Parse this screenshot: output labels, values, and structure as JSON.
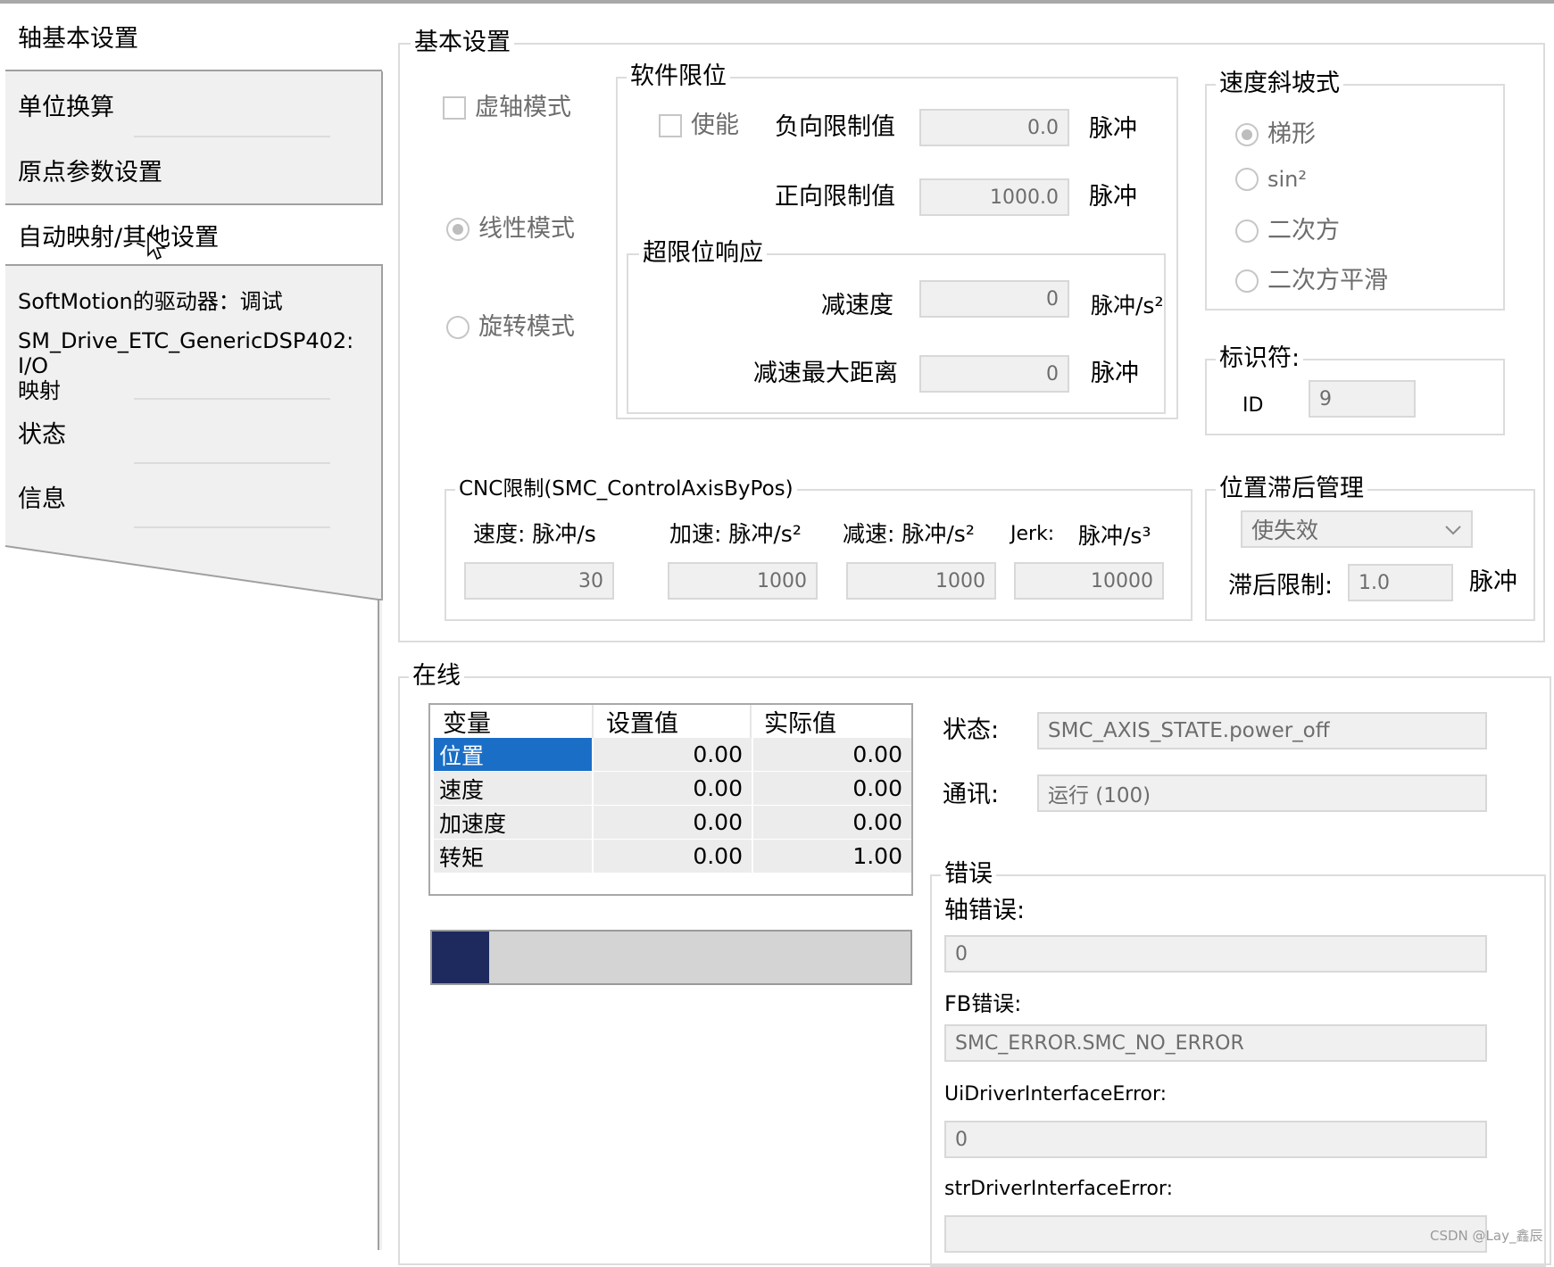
{
  "sidebar": {
    "items": [
      {
        "label": "轴基本设置"
      },
      {
        "label": "单位换算"
      },
      {
        "label": "原点参数设置"
      },
      {
        "label": "自动映射/其他设置"
      },
      {
        "label": "SoftMotion的驱动器：调试"
      },
      {
        "label": "SM_Drive_ETC_GenericDSP402: I/O\n映射"
      },
      {
        "label": "状态"
      },
      {
        "label": "信息"
      }
    ]
  },
  "basic": {
    "title": "基本设置",
    "virtual_mode": "虚轴模式",
    "linear_mode": "线性模式",
    "rotary_mode": "旋转模式",
    "soft_limit": {
      "title": "软件限位",
      "enable": "使能",
      "neg_label": "负向限制值",
      "neg_value": "0.0",
      "pos_label": "正向限制值",
      "pos_value": "1000.0",
      "unit": "脉冲",
      "overlimit_title": "超限位响应",
      "decel_label": "减速度",
      "decel_value": "0",
      "decel_unit": "脉冲/s²",
      "maxdist_label": "减速最大距离",
      "maxdist_value": "0",
      "maxdist_unit": "脉冲"
    },
    "ramp": {
      "title": "速度斜坡式",
      "options": [
        "梯形",
        "sin²",
        "二次方",
        "二次方平滑"
      ],
      "selected": "梯形"
    },
    "identifier": {
      "title": "标识符:",
      "id_label": "ID",
      "id_value": "9"
    },
    "cnc": {
      "title": "CNC限制(SMC_ControlAxisByPos)",
      "vel_label": "速度: 脉冲/s",
      "acc_label": "加速: 脉冲/s²",
      "dec_label": "减速: 脉冲/s²",
      "jerk_label": "Jerk:",
      "jerk_unit": "脉冲/s³",
      "vel_value": "30",
      "acc_value": "1000",
      "dec_value": "1000",
      "jerk_value": "10000"
    },
    "lag": {
      "title": "位置滞后管理",
      "mode": "使失效",
      "limit_label": "滞后限制:",
      "limit_value": "1.0",
      "unit": "脉冲"
    }
  },
  "online": {
    "title": "在线",
    "table": {
      "headers": [
        "变量",
        "设置值",
        "实际值"
      ],
      "rows": [
        {
          "name": "位置",
          "set": "0.00",
          "actual": "0.00"
        },
        {
          "name": "速度",
          "set": "0.00",
          "actual": "0.00"
        },
        {
          "name": "加速度",
          "set": "0.00",
          "actual": "0.00"
        },
        {
          "name": "转矩",
          "set": "0.00",
          "actual": "1.00"
        }
      ]
    },
    "progress_fraction": 0.12,
    "state_label": "状态:",
    "state_value": "SMC_AXIS_STATE.power_off",
    "comm_label": "通讯:",
    "comm_value": "运行 (100)",
    "errors": {
      "title": "错误",
      "axis_label": "轴错误:",
      "axis_value": "0",
      "fb_label": "FB错误:",
      "fb_value": "SMC_ERROR.SMC_NO_ERROR",
      "ui_label": "UiDriverInterfaceError:",
      "ui_value": "0",
      "str_label": "strDriverInterfaceError:",
      "str_value": ""
    }
  },
  "watermark": "CSDN @Lay_鑫辰",
  "colors": {
    "selection": "#1a6ec6",
    "progress_fill": "#1e2a5e",
    "panel": "#f0f0f0"
  }
}
